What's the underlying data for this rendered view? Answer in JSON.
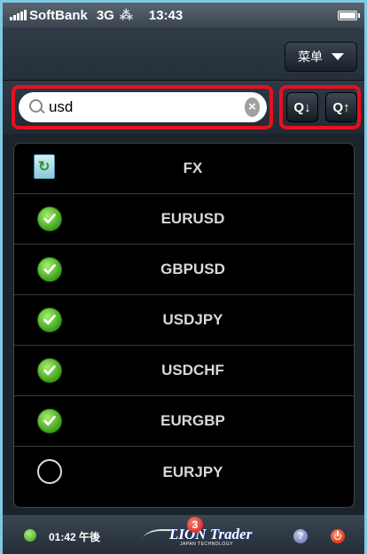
{
  "status_bar": {
    "carrier": "SoftBank",
    "network": "3G",
    "activity": "⁂",
    "time": "13:43"
  },
  "nav": {
    "menu_label": "菜单"
  },
  "search": {
    "value": "usd",
    "clear": "×"
  },
  "sort": {
    "desc_label": "Q↓",
    "asc_label": "Q↑"
  },
  "list": {
    "header": "FX",
    "items": [
      {
        "label": "EURUSD",
        "checked": true
      },
      {
        "label": "GBPUSD",
        "checked": true
      },
      {
        "label": "USDJPY",
        "checked": true
      },
      {
        "label": "USDCHF",
        "checked": true
      },
      {
        "label": "EURGBP",
        "checked": true
      },
      {
        "label": "EURJPY",
        "checked": false
      }
    ]
  },
  "footer": {
    "clock": "01:42 午後",
    "logo_text": "LION Trader",
    "logo_badge": "3",
    "logo_sub": "JAPAN TECHNOLOGY",
    "help": "?"
  }
}
